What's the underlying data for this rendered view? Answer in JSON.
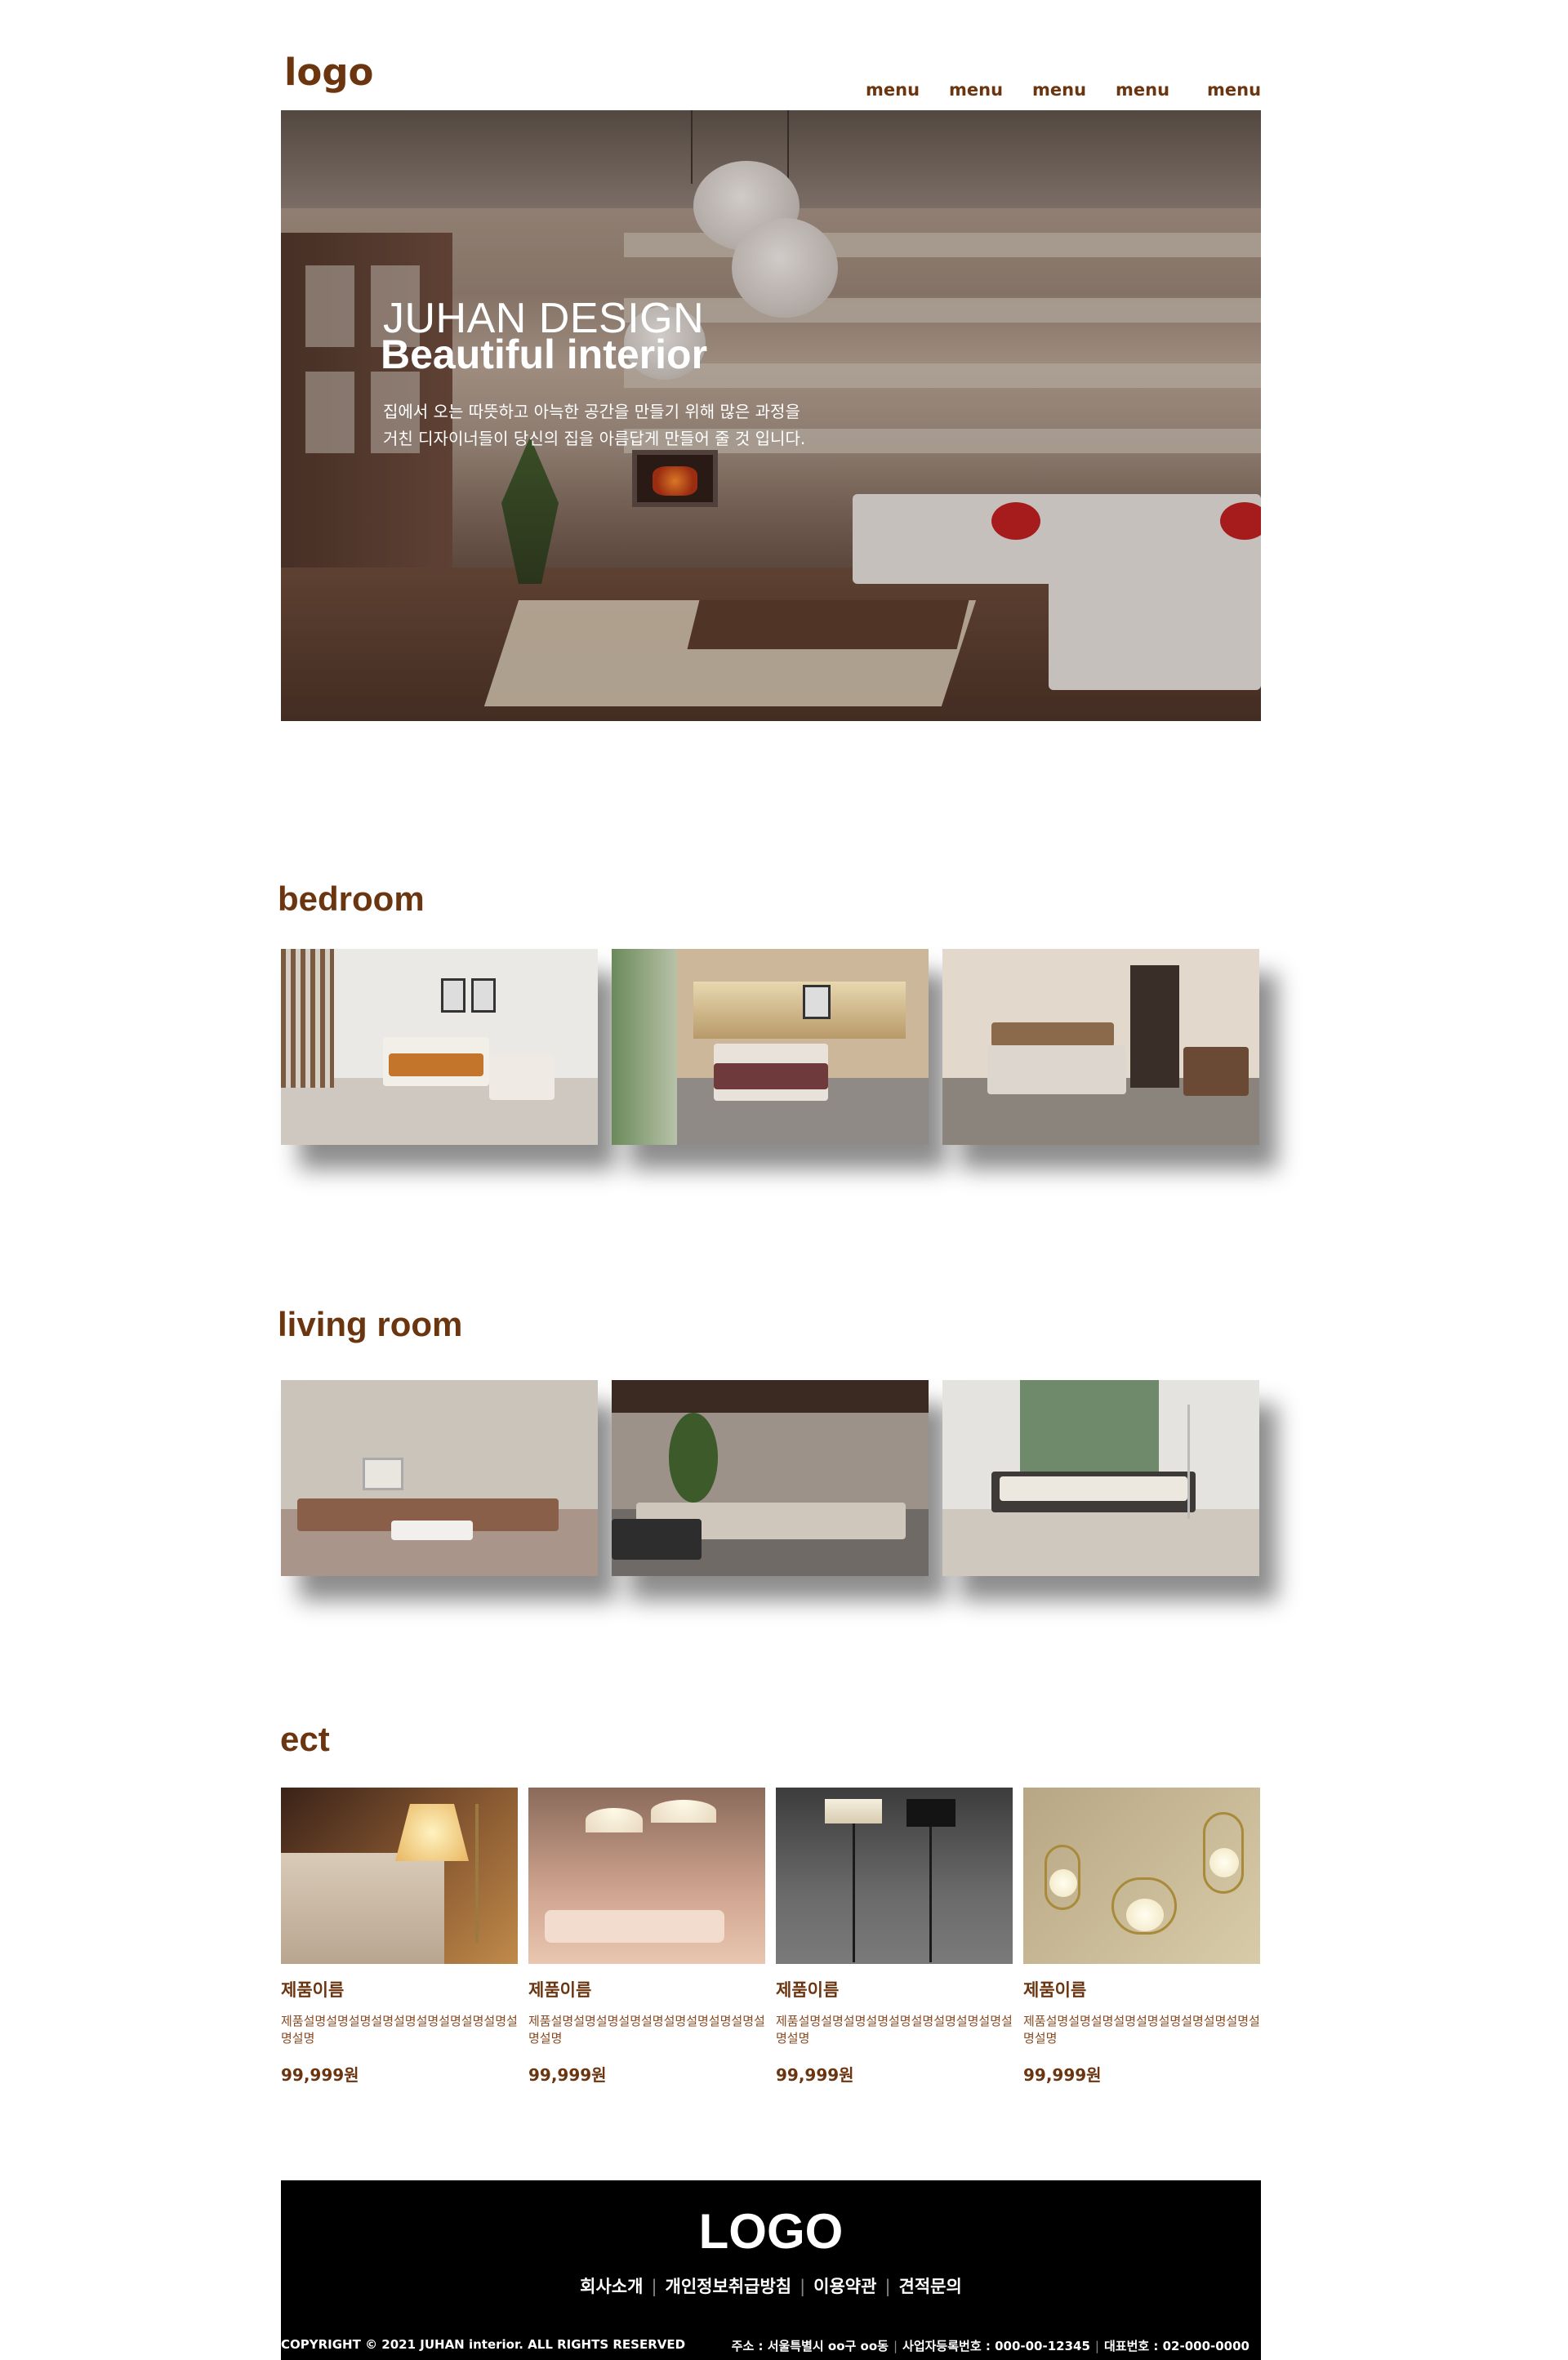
{
  "header": {
    "logo": "logo",
    "menu": [
      "menu",
      "menu",
      "menu",
      "menu",
      "menu"
    ]
  },
  "hero": {
    "subtitle": "JUHAN DESIGN",
    "title": "Beautiful interior",
    "desc_line1": "집에서 오는 따뜻하고 아늑한 공간을 만들기 위해 많은 과정을",
    "desc_line2": "거친 디자이너들이 당신의 집을 아름답게 만들어 줄 것 입니다."
  },
  "sections": {
    "bedroom": "bedroom",
    "living_room": "living room",
    "products": "ect"
  },
  "products": [
    {
      "name": "제품이름",
      "desc": "제품설명설명설명설명설명설명설명설명설명설명설명",
      "price": "99,999원"
    },
    {
      "name": "제품이름",
      "desc": "제품설명설명설명설명설명설명설명설명설명설명설명",
      "price": "99,999원"
    },
    {
      "name": "제품이름",
      "desc": "제품설명설명설명설명설명설명설명설명설명설명설명",
      "price": "99,999원"
    },
    {
      "name": "제품이름",
      "desc": "제품설명설명설명설명설명설명설명설명설명설명설명",
      "price": "99,999원"
    }
  ],
  "footer": {
    "logo": "LOGO",
    "links": [
      "회사소개",
      "개인정보취급방침",
      "이용약관",
      "견적문의"
    ],
    "copyright": "COPYRIGHT © 2021 JUHAN interior. ALL RIGHTS RESERVED",
    "address": "주소 : 서울특별시 oo구 oo동",
    "business_no": "사업자등록번호 : 000-00-12345",
    "phone": "대표번호 : 02-000-0000"
  },
  "colors": {
    "accent": "#6b3510",
    "footer_bg": "#000000"
  }
}
